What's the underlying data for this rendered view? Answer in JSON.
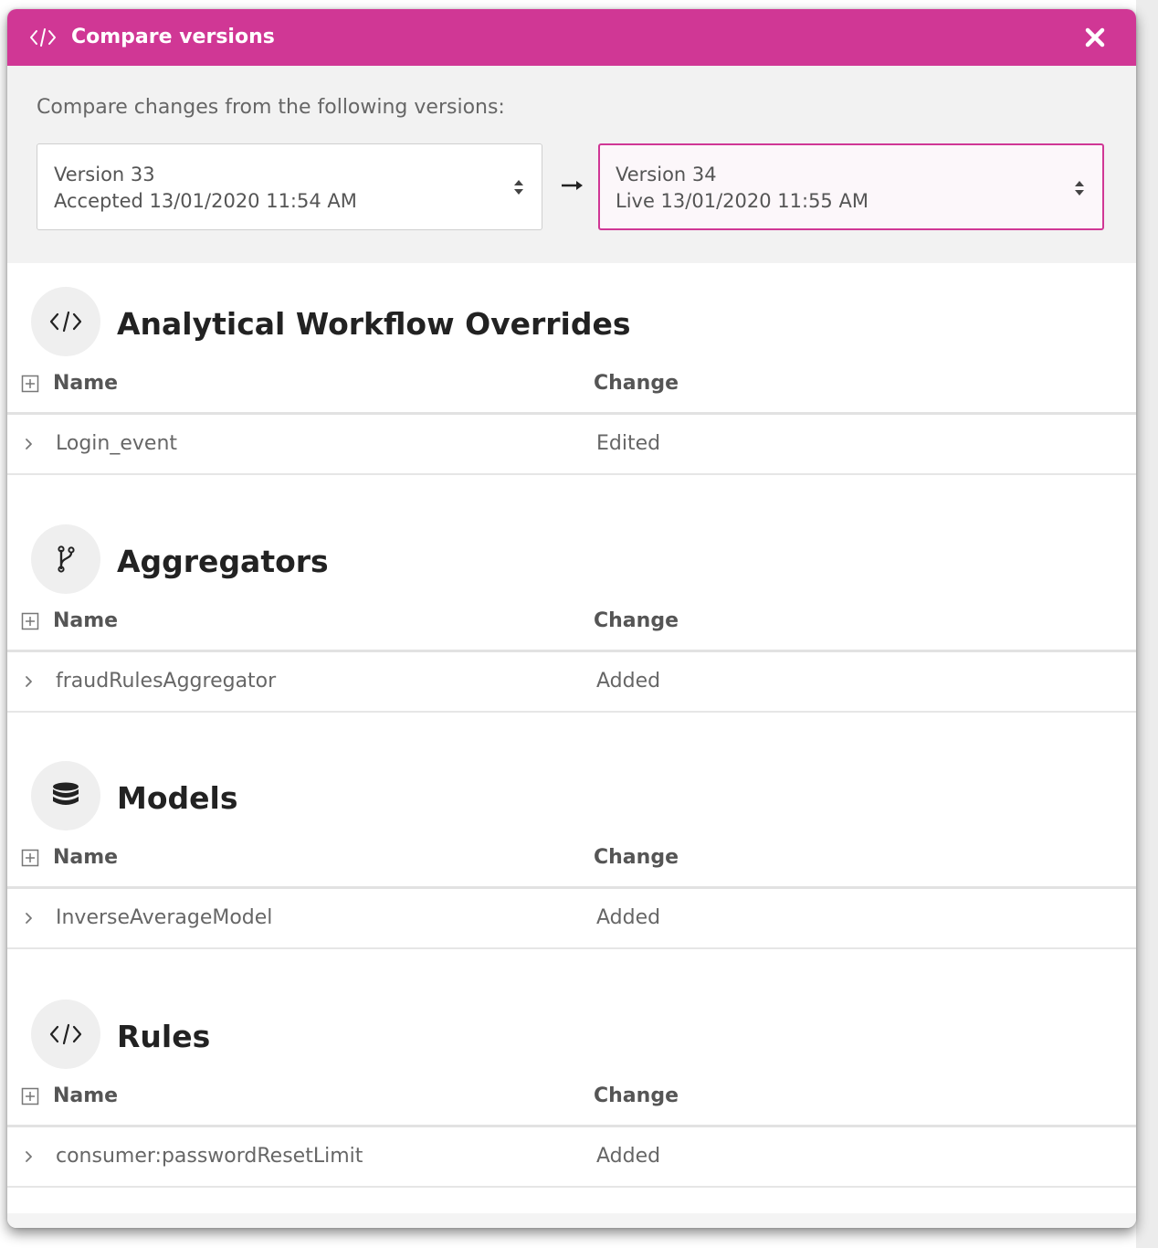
{
  "dialog": {
    "title": "Compare versions",
    "title_icon": "code-icon",
    "close_icon": "close-icon"
  },
  "compare": {
    "label": "Compare changes from the following versions:",
    "from": {
      "version": "Version 33",
      "detail": "Accepted 13/01/2020 11:54 AM"
    },
    "to": {
      "version": "Version 34",
      "detail": "Live 13/01/2020 11:55 AM"
    },
    "arrow_icon": "arrow-right-icon",
    "accent_color": "#d03795"
  },
  "columns": {
    "name": "Name",
    "change": "Change"
  },
  "sections": [
    {
      "title": "Analytical Workflow Overrides",
      "icon": "code-icon",
      "rows": [
        {
          "name": "Login_event",
          "change": "Edited"
        }
      ]
    },
    {
      "title": "Aggregators",
      "icon": "branch-icon",
      "rows": [
        {
          "name": "fraudRulesAggregator",
          "change": "Added"
        }
      ]
    },
    {
      "title": "Models",
      "icon": "database-icon",
      "rows": [
        {
          "name": "InverseAverageModel",
          "change": "Added"
        }
      ]
    },
    {
      "title": "Rules",
      "icon": "code-icon",
      "rows": [
        {
          "name": "consumer:passwordResetLimit",
          "change": "Added"
        }
      ]
    }
  ]
}
